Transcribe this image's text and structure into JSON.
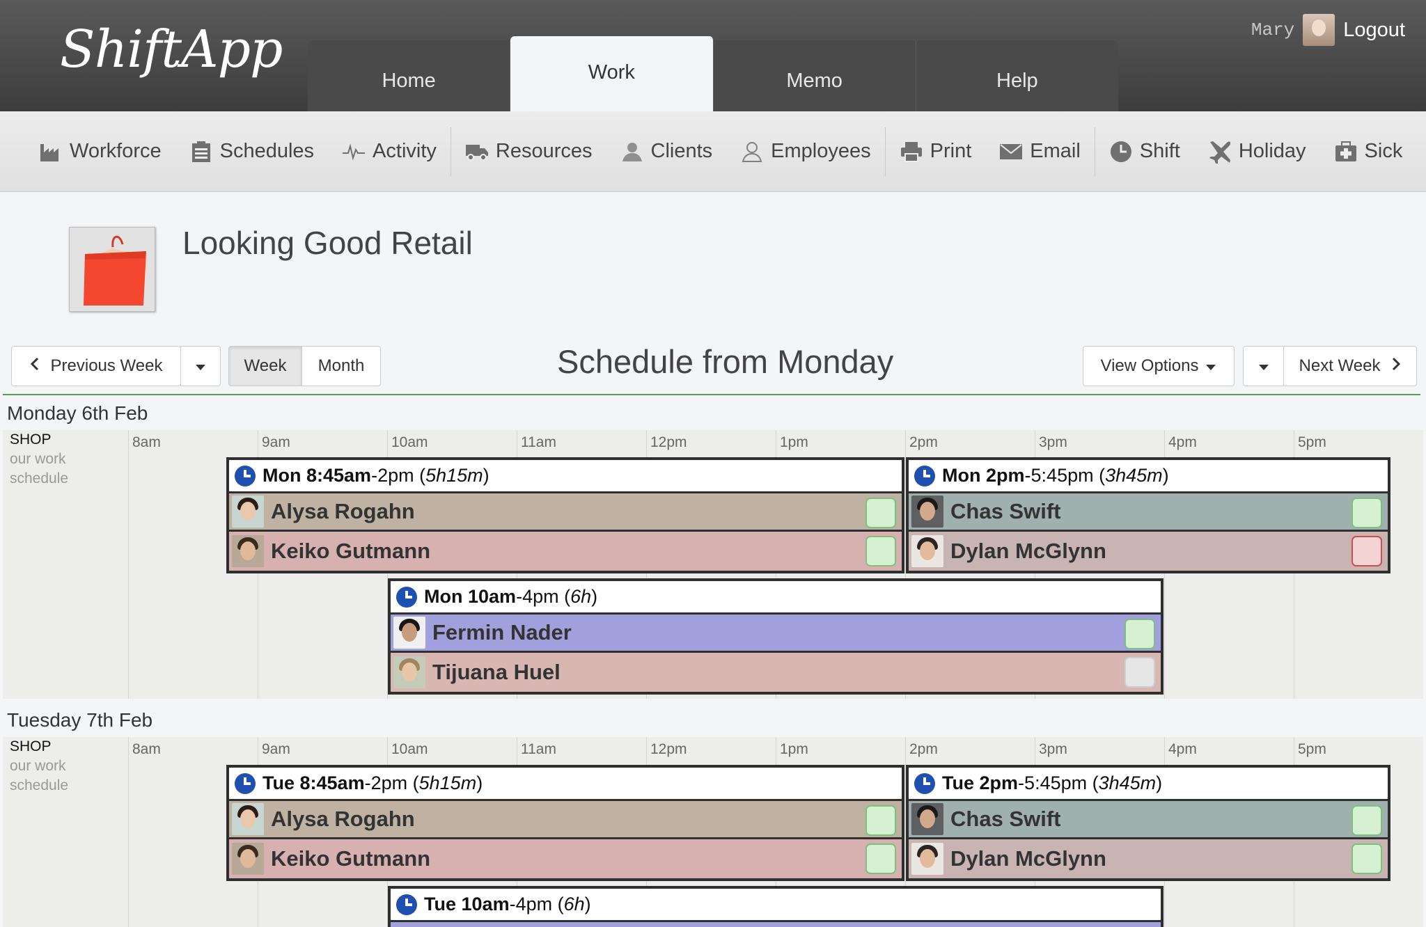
{
  "header": {
    "logo": "ShiftApp",
    "user_name": "Mary",
    "logout_label": "Logout",
    "tabs": [
      {
        "label": "Home"
      },
      {
        "label": "Work"
      },
      {
        "label": "Memo"
      },
      {
        "label": "Help"
      }
    ]
  },
  "toolbar": {
    "workforce": "Workforce",
    "schedules": "Schedules",
    "activity": "Activity",
    "resources": "Resources",
    "clients": "Clients",
    "employees": "Employees",
    "print": "Print",
    "email": "Email",
    "shift": "Shift",
    "holiday": "Holiday",
    "sick": "Sick"
  },
  "company": {
    "name": "Looking Good Retail"
  },
  "nav": {
    "previous_week": "Previous Week",
    "week": "Week",
    "month": "Month",
    "title": "Schedule from Monday",
    "view_options": "View Options",
    "next_week": "Next Week"
  },
  "hours": [
    "8am",
    "9am",
    "10am",
    "11am",
    "12pm",
    "1pm",
    "2pm",
    "3pm",
    "4pm",
    "5pm"
  ],
  "days": [
    {
      "label": "Monday 6th Feb",
      "location": {
        "name": "SHOP",
        "description": "our work schedule"
      },
      "shifts": [
        {
          "day": "Mon",
          "start": "8:45am",
          "end": "2pm",
          "duration": "5h15m",
          "employees": [
            {
              "name": "Alysa Rogahn",
              "status": "confirmed"
            },
            {
              "name": "Keiko Gutmann",
              "status": "confirmed"
            }
          ]
        },
        {
          "day": "Mon",
          "start": "2pm",
          "end": "5:45pm",
          "duration": "3h45m",
          "employees": [
            {
              "name": "Chas Swift",
              "status": "confirmed"
            },
            {
              "name": "Dylan McGlynn",
              "status": "declined"
            }
          ]
        },
        {
          "day": "Mon",
          "start": "10am",
          "end": "4pm",
          "duration": "6h",
          "employees": [
            {
              "name": "Fermin Nader",
              "status": "confirmed"
            },
            {
              "name": "Tijuana Huel",
              "status": "pending"
            }
          ]
        }
      ]
    },
    {
      "label": "Tuesday 7th Feb",
      "location": {
        "name": "SHOP",
        "description": "our work schedule"
      },
      "shifts": [
        {
          "day": "Tue",
          "start": "8:45am",
          "end": "2pm",
          "duration": "5h15m",
          "employees": [
            {
              "name": "Alysa Rogahn",
              "status": "confirmed"
            },
            {
              "name": "Keiko Gutmann",
              "status": "confirmed"
            }
          ]
        },
        {
          "day": "Tue",
          "start": "2pm",
          "end": "5:45pm",
          "duration": "3h45m",
          "employees": [
            {
              "name": "Chas Swift",
              "status": "confirmed"
            },
            {
              "name": "Dylan McGlynn",
              "status": "confirmed"
            }
          ]
        },
        {
          "day": "Tue",
          "start": "10am",
          "end": "4pm",
          "duration": "6h",
          "employees": []
        }
      ]
    }
  ],
  "colors": {
    "accent_blue": "#1f4fb0",
    "status_confirmed": "#d5f1d2",
    "status_declined": "#f3d3d3",
    "status_pending": "#e6e6e6"
  }
}
